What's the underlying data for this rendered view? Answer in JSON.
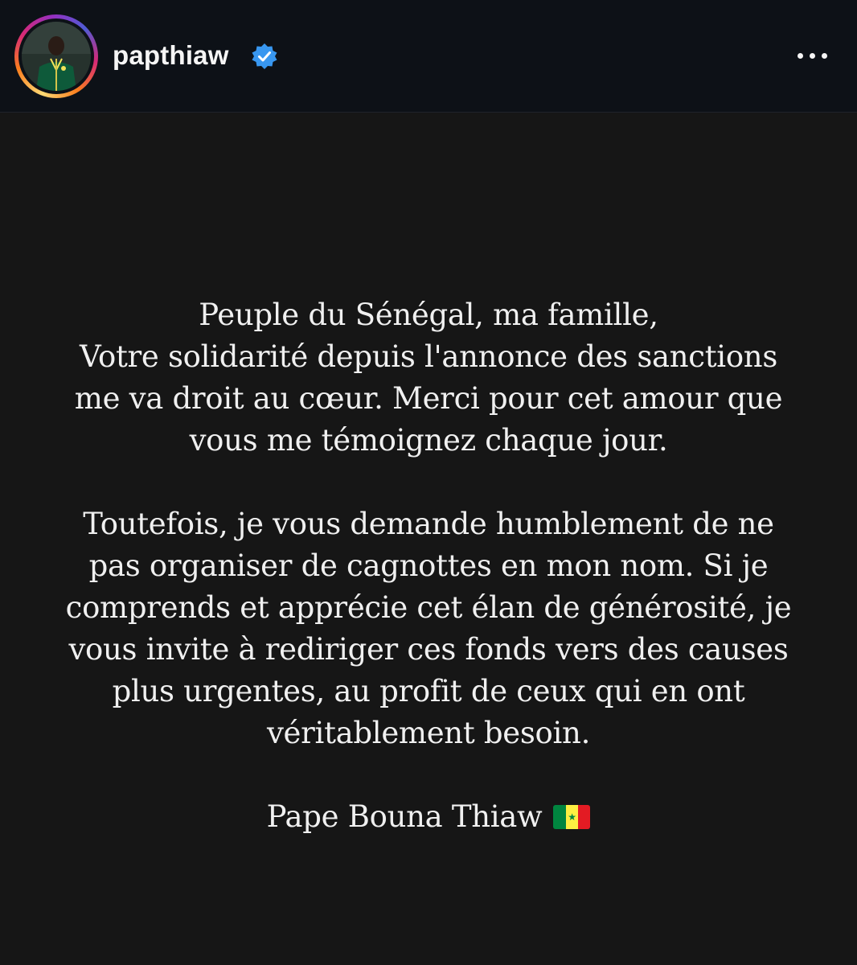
{
  "profile": {
    "username": "papthiaw",
    "verified_icon": "verified-badge-icon",
    "avatar_icon": "profile-photo",
    "more_icon": "more-options-icon"
  },
  "colors": {
    "header_bg": "#0d1117",
    "content_bg": "#161616",
    "text": "#f0f0f0",
    "verified_blue": "#3897f0"
  },
  "message": {
    "paragraph1": [
      "Peuple du Sénégal, ma famille,",
      "Votre solidarité depuis l'annonce des sanctions",
      "me va droit au cœur. Merci pour cet amour que",
      "vous me témoignez chaque jour."
    ],
    "paragraph2": [
      "Toutefois, je vous demande humblement de ne",
      "pas organiser de cagnottes en mon nom. Si je",
      "comprends et apprécie cet élan de générosité, je",
      "vous invite à rediriger ces fonds vers des causes",
      "plus urgentes, au profit de ceux qui en ont",
      "véritablement besoin."
    ],
    "signature": "Pape Bouna Thiaw",
    "signature_icon": "senegal-flag-icon"
  }
}
